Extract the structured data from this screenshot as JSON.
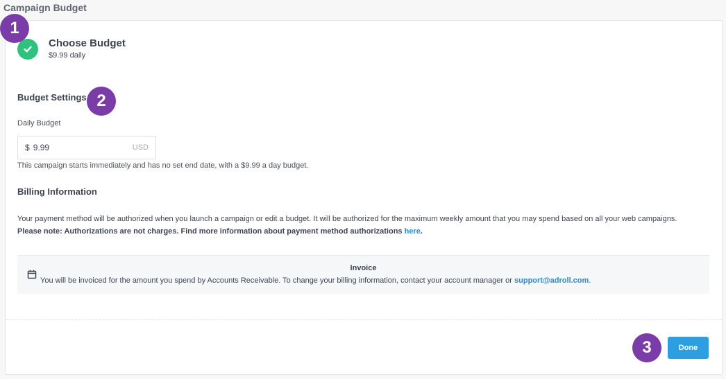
{
  "page": {
    "title": "Campaign Budget"
  },
  "step": {
    "title": "Choose Budget",
    "summary": "$9.99 daily"
  },
  "budget_settings": {
    "title": "Budget Settings",
    "daily_label": "Daily Budget",
    "currency_symbol": "$",
    "value": "9.99",
    "unit": "USD",
    "helper": "This campaign starts immediately and has no set end date, with a $9.99 a day budget."
  },
  "billing": {
    "title": "Billing Information",
    "paragraph": "Your payment method will be authorized when you launch a campaign or edit a budget. It will be authorized for the maximum weekly amount that you may spend based on all your web campaigns.",
    "note_prefix": "Please note: Authorizations are not charges. Find more information about payment method authorizations ",
    "note_link": "here",
    "note_suffix": ".",
    "invoice": {
      "title": "Invoice",
      "text": "You will be invoiced for the amount you spend by Accounts Receivable. To change your billing information, contact your account manager or ",
      "email": "support@adroll.com",
      "suffix": "."
    }
  },
  "actions": {
    "done_label": "Done"
  },
  "badges": [
    "1",
    "2",
    "3"
  ],
  "colors": {
    "accent": "#2d9fe0",
    "success": "#2ec27e",
    "badge": "#7a3ca6",
    "link": "#2a8bd0"
  }
}
